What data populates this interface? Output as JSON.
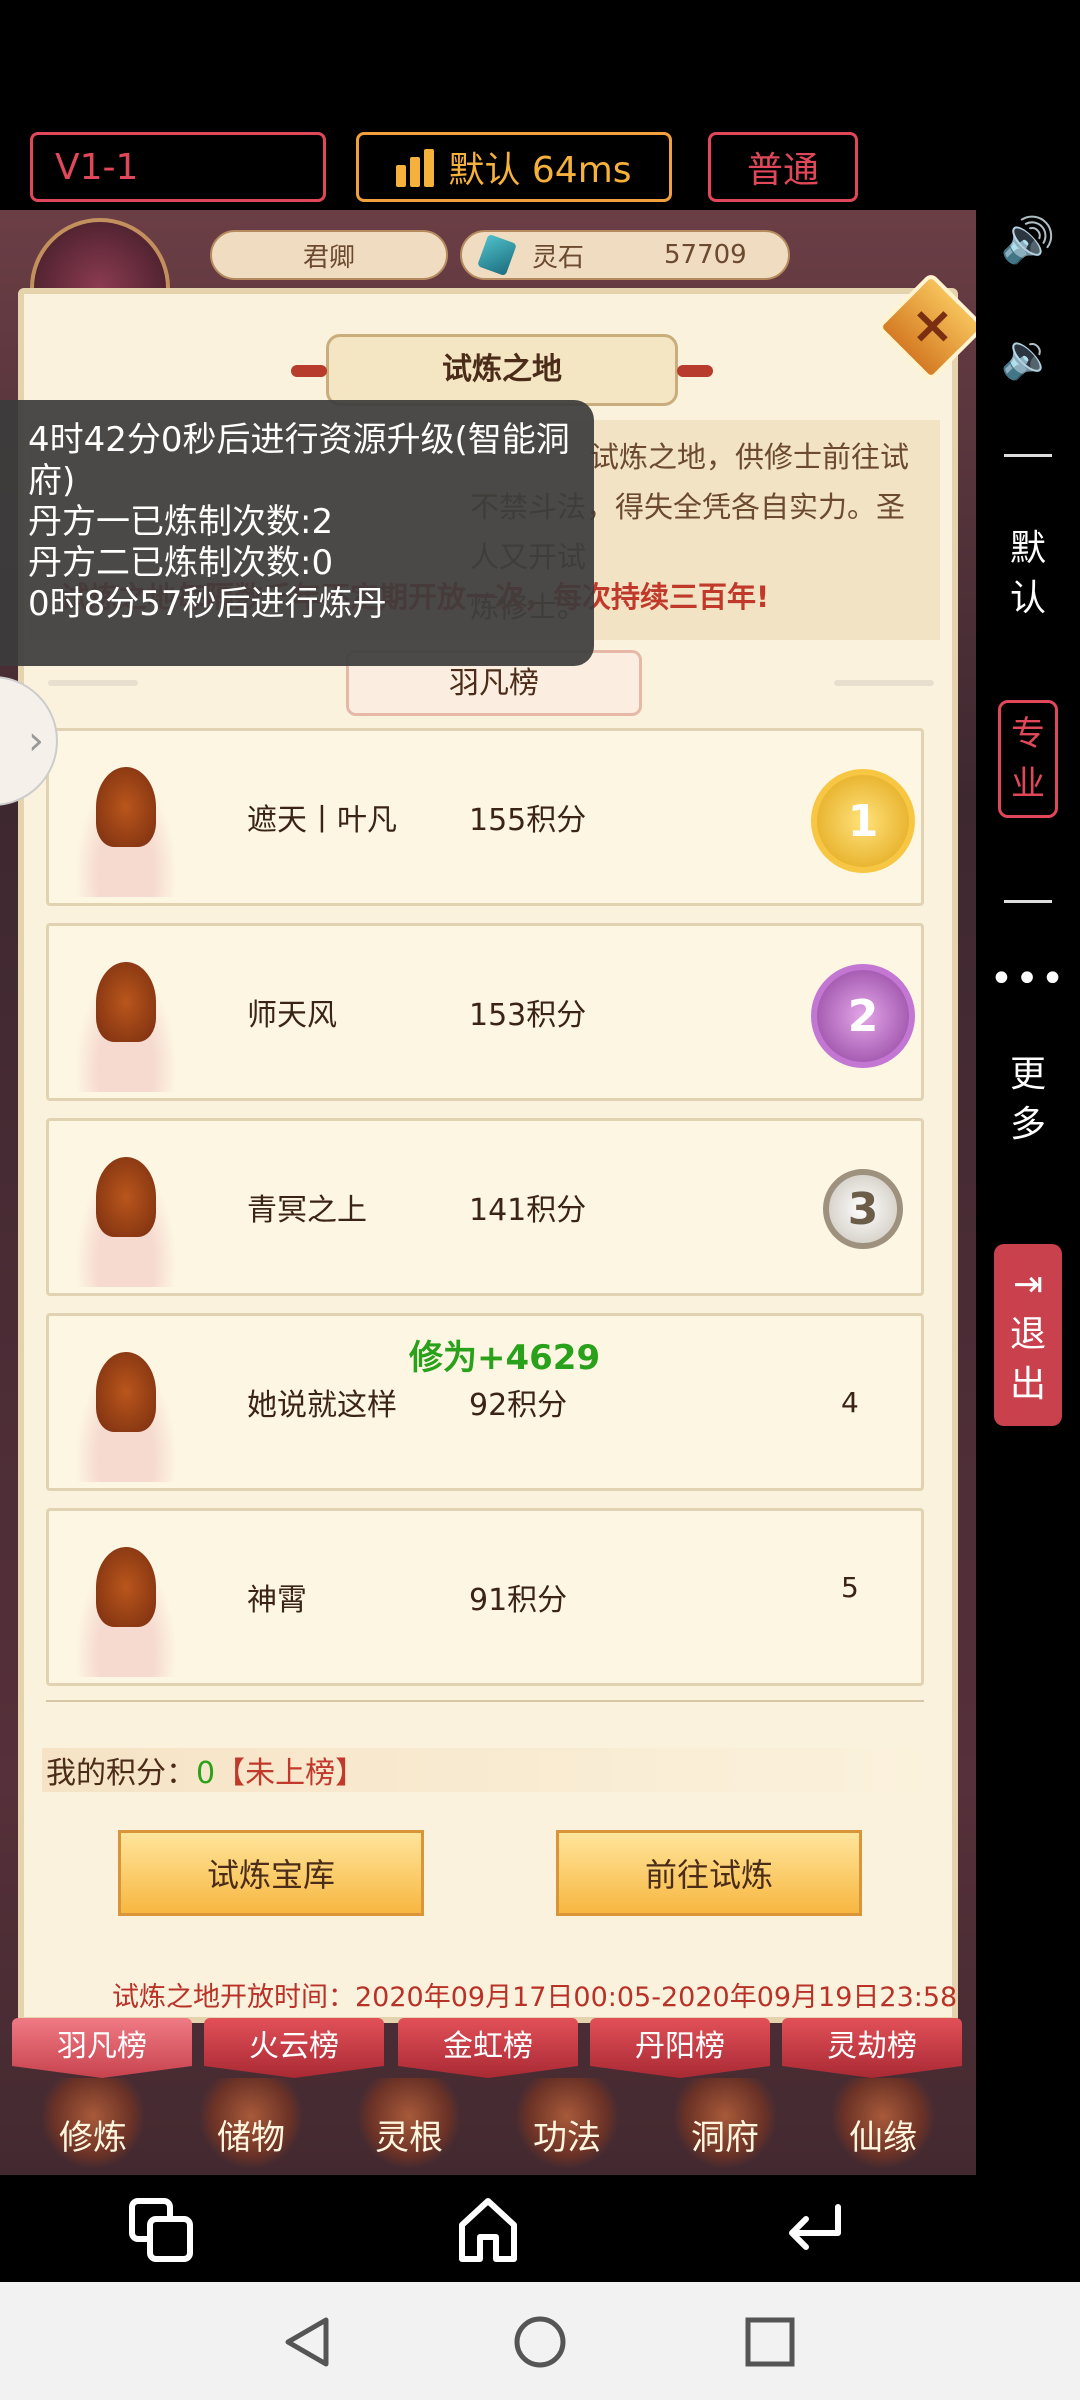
{
  "top_bar": {
    "version": "V1-1",
    "network": "默认 64ms",
    "mode": "普通"
  },
  "side_panel": {
    "default_label": "默认",
    "pro_label": "专业",
    "more_label": "更多",
    "exit_label": "退出"
  },
  "hud": {
    "player_name": "君卿",
    "currency_name": "灵石",
    "currency_value": "57709"
  },
  "panel": {
    "title": "试炼之地",
    "desc_line1": "试炼之地，供修士前往试",
    "desc_line2": "不禁斗法，得失全凭各自实力。圣人又开试",
    "desc_line3": "炼修士。",
    "desc_red": "试炼之地每隔数千年不定期开放一次，每次持续三百年!",
    "board_title": "羽凡榜"
  },
  "overlay": {
    "line1": "4时42分0秒后进行资源升级(智能洞府)",
    "line2": "丹方一已炼制次数:2",
    "line3": "丹方二已炼制次数:0",
    "line4": "0时8分57秒后进行炼丹"
  },
  "ranking": [
    {
      "name": "遮天丨叶凡",
      "score": "155积分",
      "rank": "1"
    },
    {
      "name": "师天风",
      "score": "153积分",
      "rank": "2"
    },
    {
      "name": "青冥之上",
      "score": "141积分",
      "rank": "3"
    },
    {
      "name": "她说就这样",
      "score": "92积分",
      "rank": "4"
    },
    {
      "name": "神霄",
      "score": "91积分",
      "rank": "5"
    }
  ],
  "floating_gain": "修为+4629",
  "my_score": {
    "label": "我的积分：",
    "value": "0",
    "status": "【未上榜】"
  },
  "buttons": {
    "treasury": "试炼宝库",
    "go_trial": "前往试炼"
  },
  "open_time": "试炼之地开放时间：2020年09月17日00:05-2020年09月19日23:58",
  "tabs": [
    "羽凡榜",
    "火云榜",
    "金虹榜",
    "丹阳榜",
    "灵劫榜"
  ],
  "bottom_menu": [
    "修炼",
    "储物",
    "灵根",
    "功法",
    "洞府",
    "仙缘"
  ],
  "colors": {
    "accent_red": "#e0485a",
    "accent_orange": "#f6b13c",
    "panel_bg": "#fbf2dd",
    "gain_green": "#2aa11a"
  }
}
